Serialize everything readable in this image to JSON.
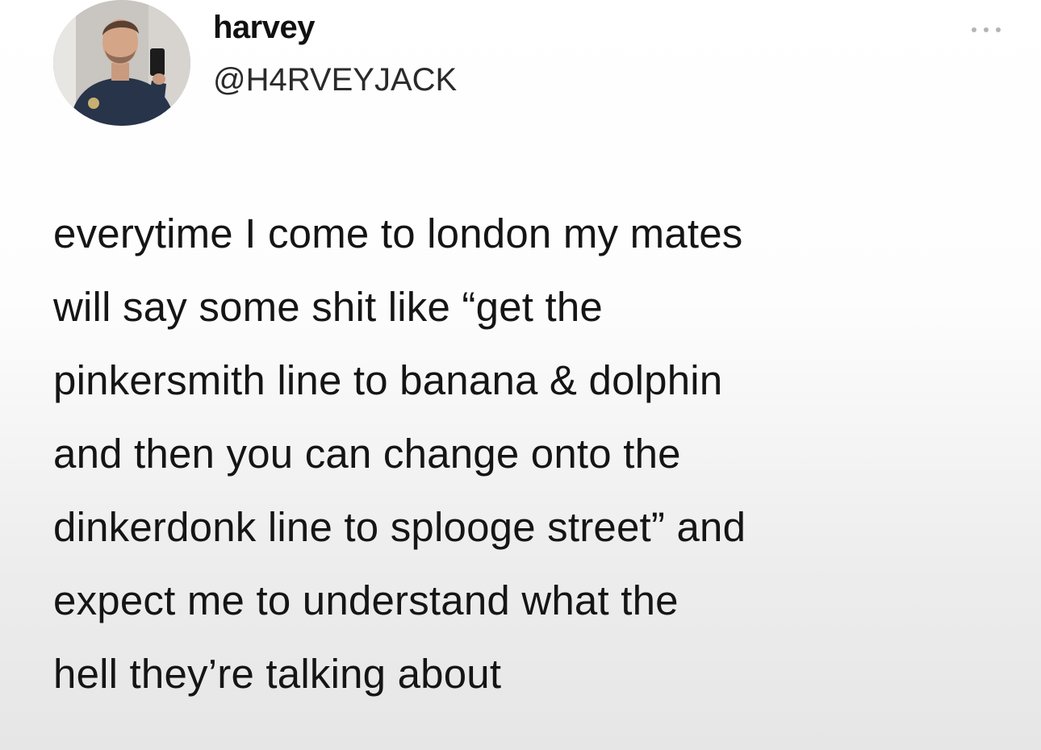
{
  "author": {
    "display_name": "harvey",
    "handle": "@H4RVEYJACK",
    "avatar_icon": "profile-photo"
  },
  "menu": {
    "more_icon": "ellipsis-icon"
  },
  "tweet": {
    "lines": [
      "everytime I come to london my mates",
      "will say some shit like “get the",
      "pinkersmith line to banana & dolphin",
      "and then you can change onto the",
      "dinkerdonk line to splooge street” and",
      "expect me to understand what the",
      "hell they’re talking about"
    ]
  }
}
